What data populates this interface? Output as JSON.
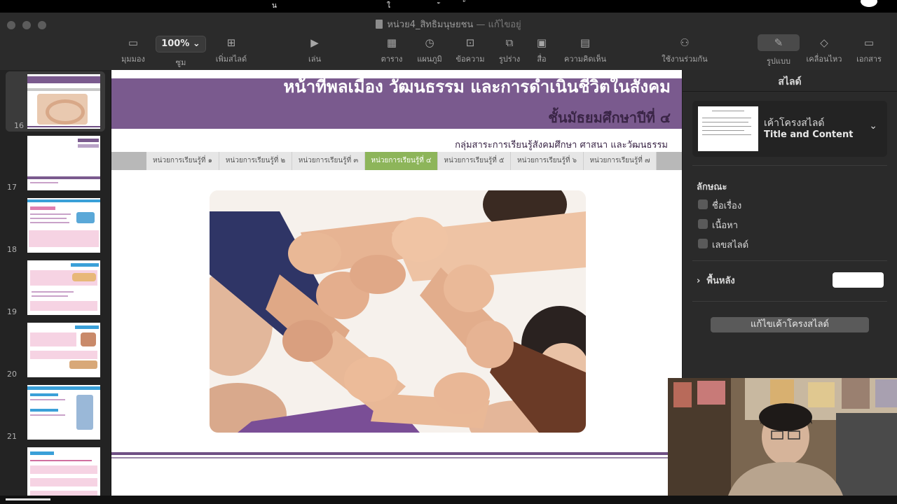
{
  "window": {
    "title": "หน่วย4_สิทธิมนุษยชน",
    "edited_suffix": "— แก้ไขอยู่",
    "topstrip_glyphs": [
      "น",
      "ใ",
      "ั",
      "้"
    ]
  },
  "toolbar": {
    "view": {
      "label": "มุมมอง",
      "icon": "sidebar-icon"
    },
    "zoom": {
      "value": "100%",
      "label": "ซูม"
    },
    "add_slide": {
      "label": "เพิ่มสไลด์",
      "icon": "plus-icon"
    },
    "play": {
      "label": "เล่น",
      "icon": "play-icon"
    },
    "table": {
      "label": "ตาราง",
      "icon": "table-icon"
    },
    "chart": {
      "label": "แผนภูมิ",
      "icon": "chart-icon"
    },
    "text": {
      "label": "ข้อความ",
      "icon": "text-icon"
    },
    "shape": {
      "label": "รูปร่าง",
      "icon": "shape-icon"
    },
    "media": {
      "label": "สื่อ",
      "icon": "media-icon"
    },
    "comment": {
      "label": "ความคิดเห็น",
      "icon": "comment-icon"
    },
    "collaborate": {
      "label": "ใช้งานร่วมกัน",
      "icon": "collaborate-icon"
    },
    "format": {
      "label": "รูปแบบ",
      "icon": "brush-icon"
    },
    "animate": {
      "label": "เคลื่อนไหว",
      "icon": "diamond-icon"
    },
    "document": {
      "label": "เอกสาร",
      "icon": "document-icon"
    }
  },
  "navigator": {
    "slides": [
      {
        "number": "16",
        "selected": true
      },
      {
        "number": "17",
        "selected": false
      },
      {
        "number": "18",
        "selected": false
      },
      {
        "number": "19",
        "selected": false
      },
      {
        "number": "20",
        "selected": false
      },
      {
        "number": "21",
        "selected": false
      },
      {
        "number": "",
        "selected": false
      }
    ]
  },
  "slide": {
    "title": "หน้าที่พลเมือง วัฒนธรรม และการดำเนินชีวิตในสังคม",
    "grade": "ชั้นมัธยมศึกษาปีที่ ๔",
    "subject": "กลุ่มสาระการเรียนรู้สังคมศึกษา ศาสนา และวัฒนธรรม",
    "tabs": [
      "หน่วยการเรียนรู้ที่ ๑",
      "หน่วยการเรียนรู้ที่ ๒",
      "หน่วยการเรียนรู้ที่ ๓",
      "หน่วยการเรียนรู้ที่ ๔",
      "หน่วยการเรียนรู้ที่ ๕",
      "หน่วยการเรียนรู้ที่ ๖",
      "หน่วยการเรียนรู้ที่ ๗"
    ],
    "active_tab": 3,
    "colors": {
      "banner": "#7a5a8e",
      "active_tab": "#8db55a",
      "title_text": "#ffffff",
      "grade_text": "#3a2546"
    }
  },
  "inspector": {
    "title": "สไลด์",
    "layout_label": "เค้าโครงสไลด์",
    "layout_name": "Title and Content",
    "appearance_label": "ลักษณะ",
    "checkboxes": [
      {
        "label": "ชื่อเรื่อง",
        "checked": false
      },
      {
        "label": "เนื้อหา",
        "checked": false
      },
      {
        "label": "เลขสไลด์",
        "checked": false
      }
    ],
    "background_label": "พื้นหลัง",
    "background_color": "#ffffff",
    "edit_layout_button": "แก้ไขเค้าโครงสไลด์"
  }
}
